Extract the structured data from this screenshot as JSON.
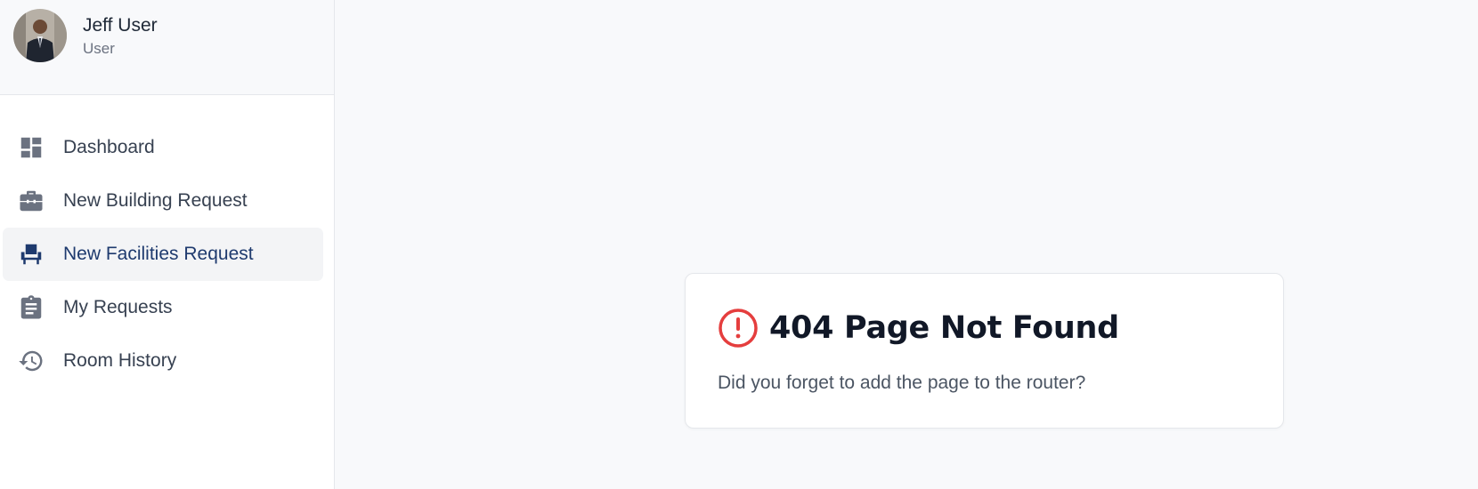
{
  "user": {
    "name": "Jeff User",
    "role": "User"
  },
  "nav": {
    "items": [
      {
        "label": "Dashboard",
        "icon": "dashboard-icon",
        "active": false
      },
      {
        "label": "New Building Request",
        "icon": "briefcase-icon",
        "active": false
      },
      {
        "label": "New Facilities Request",
        "icon": "chair-icon",
        "active": true
      },
      {
        "label": "My Requests",
        "icon": "clipboard-icon",
        "active": false
      },
      {
        "label": "Room History",
        "icon": "history-icon",
        "active": false
      }
    ]
  },
  "error": {
    "title": "404 Page Not Found",
    "message": "Did you forget to add the page to the router?",
    "icon": "alert-circle-icon"
  },
  "colors": {
    "active_nav": "#1e3a6e",
    "error_icon": "#e53e3e",
    "icon_gray": "#6b7280"
  }
}
